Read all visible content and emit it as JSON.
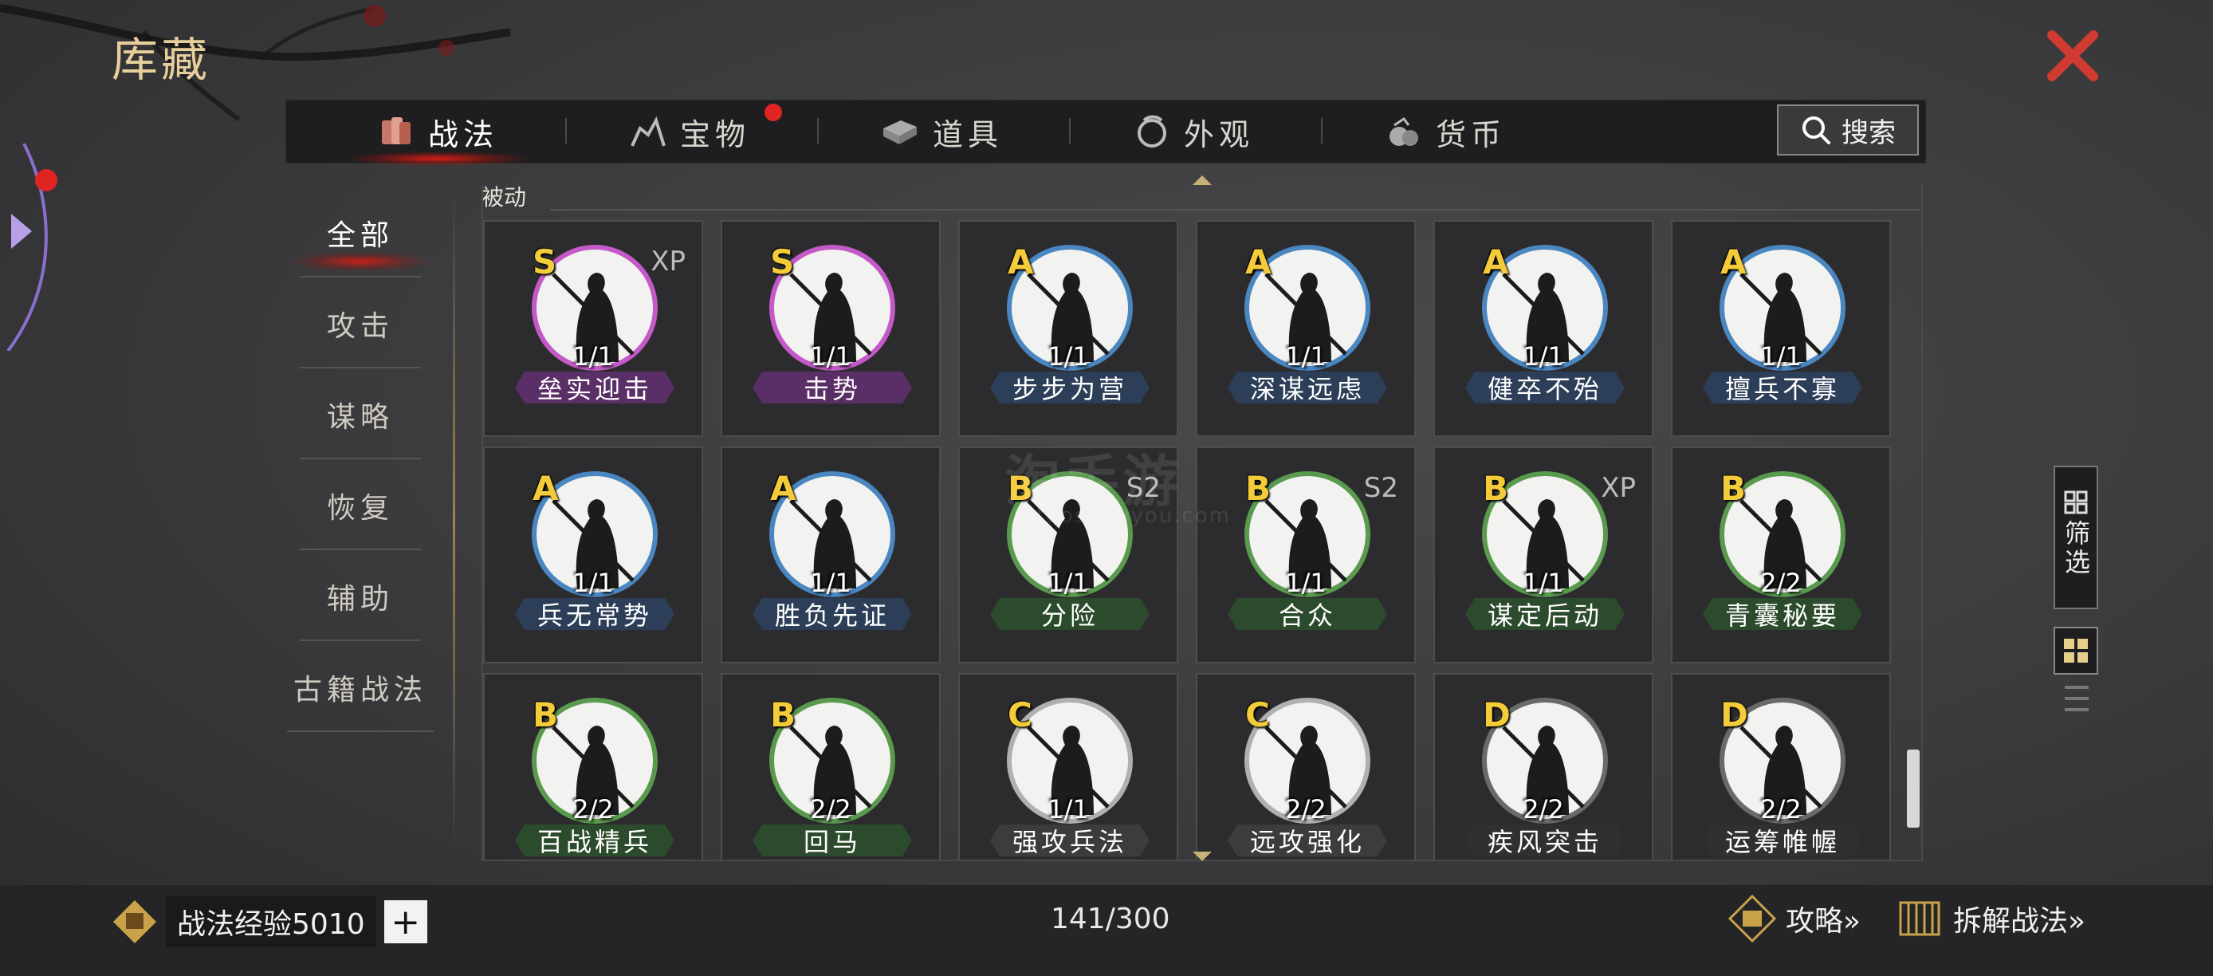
{
  "title": "库藏",
  "tabs": [
    {
      "label": "战法",
      "icon": "scroll-bundle-icon",
      "active": true,
      "badge": false
    },
    {
      "label": "宝物",
      "icon": "treasure-horse-icon",
      "active": false,
      "badge": true
    },
    {
      "label": "道具",
      "icon": "item-box-icon",
      "active": false,
      "badge": false
    },
    {
      "label": "外观",
      "icon": "appearance-icon",
      "active": false,
      "badge": false
    },
    {
      "label": "货币",
      "icon": "coin-bag-icon",
      "active": false,
      "badge": false
    }
  ],
  "search": {
    "label": "搜索"
  },
  "categories": [
    {
      "label": "全部",
      "active": true
    },
    {
      "label": "攻击",
      "active": false
    },
    {
      "label": "谋略",
      "active": false
    },
    {
      "label": "恢复",
      "active": false
    },
    {
      "label": "辅助",
      "active": false
    },
    {
      "label": "古籍战法",
      "active": false
    }
  ],
  "section_label": "被动",
  "cards": [
    {
      "grade": "S",
      "tag": "XP",
      "count": "1/1",
      "name": "垒实迎击",
      "tier": "S"
    },
    {
      "grade": "S",
      "tag": "",
      "count": "1/1",
      "name": "击势",
      "tier": "S"
    },
    {
      "grade": "A",
      "tag": "",
      "count": "1/1",
      "name": "步步为营",
      "tier": "A"
    },
    {
      "grade": "A",
      "tag": "",
      "count": "1/1",
      "name": "深谋远虑",
      "tier": "A"
    },
    {
      "grade": "A",
      "tag": "",
      "count": "1/1",
      "name": "健卒不殆",
      "tier": "A"
    },
    {
      "grade": "A",
      "tag": "",
      "count": "1/1",
      "name": "擅兵不寡",
      "tier": "A"
    },
    {
      "grade": "A",
      "tag": "",
      "count": "1/1",
      "name": "兵无常势",
      "tier": "A"
    },
    {
      "grade": "A",
      "tag": "",
      "count": "1/1",
      "name": "胜负先证",
      "tier": "A"
    },
    {
      "grade": "B",
      "tag": "S2",
      "count": "1/1",
      "name": "分险",
      "tier": "B"
    },
    {
      "grade": "B",
      "tag": "S2",
      "count": "1/1",
      "name": "合众",
      "tier": "B"
    },
    {
      "grade": "B",
      "tag": "XP",
      "count": "1/1",
      "name": "谋定后动",
      "tier": "B"
    },
    {
      "grade": "B",
      "tag": "",
      "count": "2/2",
      "name": "青囊秘要",
      "tier": "B"
    },
    {
      "grade": "B",
      "tag": "",
      "count": "2/2",
      "name": "百战精兵",
      "tier": "B"
    },
    {
      "grade": "B",
      "tag": "",
      "count": "2/2",
      "name": "回马",
      "tier": "B"
    },
    {
      "grade": "C",
      "tag": "",
      "count": "1/1",
      "name": "强攻兵法",
      "tier": "C"
    },
    {
      "grade": "C",
      "tag": "",
      "count": "2/2",
      "name": "远攻强化",
      "tier": "C"
    },
    {
      "grade": "D",
      "tag": "",
      "count": "2/2",
      "name": "疾风突击",
      "tier": "D"
    },
    {
      "grade": "D",
      "tag": "",
      "count": "2/2",
      "name": "运筹帷幄",
      "tier": "D"
    }
  ],
  "tier_colors": {
    "S": {
      "ring": "#c35ac8",
      "banner": "#5a2e66"
    },
    "A": {
      "ring": "#4a86c0",
      "banner": "#2c3e58"
    },
    "B": {
      "ring": "#5a9a4e",
      "banner": "#2c4a2c"
    },
    "C": {
      "ring": "#b0b0b0",
      "banner": "#3c3c3e"
    },
    "D": {
      "ring": "#6a6a6a",
      "banner": "#303032"
    }
  },
  "filter": {
    "label": "筛选"
  },
  "bottom": {
    "exp_label": "战法经验5010",
    "plus": "+",
    "capacity": "141/300",
    "guide": "攻略»",
    "dismantle": "拆解战法»"
  },
  "watermark": {
    "main": "淘手游",
    "sub": "taoshouyou.com"
  }
}
